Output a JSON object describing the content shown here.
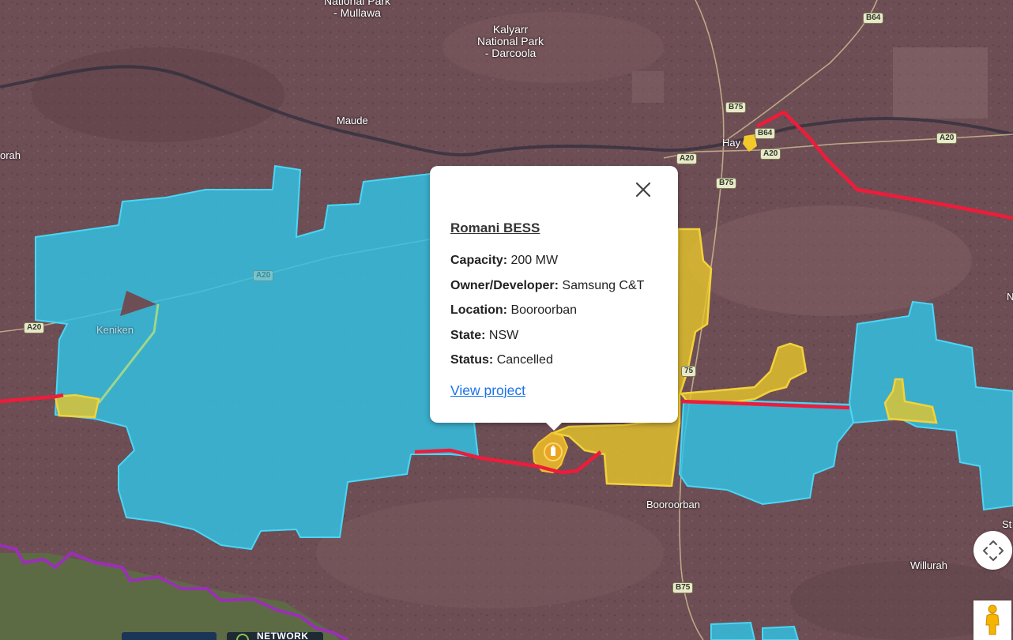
{
  "places": {
    "national_park_mullawa_top": "National Park",
    "national_park_mullawa_bottom": "- Mullawa",
    "kalyarr_line1": "Kalyarr",
    "kalyarr_line2": "National Park",
    "kalyarr_line3": "- Darcoola",
    "maude": "Maude",
    "orah": "orah",
    "hay": "Hay",
    "keniken": "Keniken",
    "booroorban": "Booroorban",
    "willurah": "Willurah",
    "edge_n": "N",
    "edge_st": "St"
  },
  "road_shields": {
    "b64_top": "B64",
    "b75_top": "B75",
    "b64_hay": "B64",
    "a20_hay": "A20",
    "a20_west_of_hay": "A20",
    "a20_east": "A20",
    "b75_mid": "B75",
    "a20_left": "A20",
    "a20_faint": "A20",
    "b75_popup_side": "75",
    "b75_bottom": "B75"
  },
  "popup": {
    "title": "Romani BESS",
    "fields": [
      {
        "key": "Capacity:",
        "value": "200 MW"
      },
      {
        "key": "Owner/Developer:",
        "value": "Samsung C&T"
      },
      {
        "key": "Location:",
        "value": "Booroorban"
      },
      {
        "key": "State:",
        "value": "NSW"
      },
      {
        "key": "Status:",
        "value": "Cancelled"
      }
    ],
    "link": "View project",
    "close_icon": "close-icon"
  },
  "bottom_badges": {
    "network_label": "NETWORK"
  },
  "colors": {
    "terrain": "#6e4e55",
    "solar_zone": "#2fc3e6",
    "bess_zone": "#e6c52a",
    "transmission_line": "#ee1c3a",
    "boundary_line": "#9b2fb5",
    "road": "#c8b98f",
    "link": "#1a73e8"
  },
  "controls": {
    "nav_icon": "compass-arrows-icon",
    "pegman_icon": "pegman-icon"
  }
}
